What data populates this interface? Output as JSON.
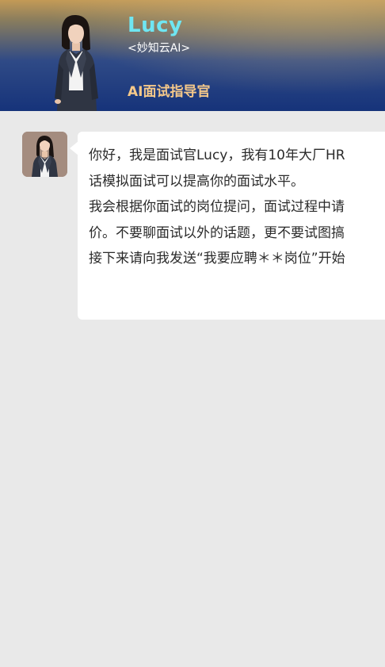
{
  "header": {
    "name": "Lucy",
    "company": "<妙知云AI>",
    "role": "AI面试指导官"
  },
  "chat": {
    "messages": [
      {
        "sender": "bot",
        "avatar_icon": "lucy-avatar",
        "lines": [
          "你好，我是面试官Lucy，我有10年大厂HR",
          "话模拟面试可以提高你的面试水平。",
          "我会根据你面试的岗位提问，面试过程中请",
          "价。不要聊面试以外的话题，更不要试图搞",
          "接下来请向我发送“我要应聘＊＊岗位”开始"
        ]
      }
    ]
  },
  "colors": {
    "name": "#6fe6f2",
    "role": "#f6c98a",
    "background": "#e9e9e9",
    "bubble": "#ffffff"
  }
}
